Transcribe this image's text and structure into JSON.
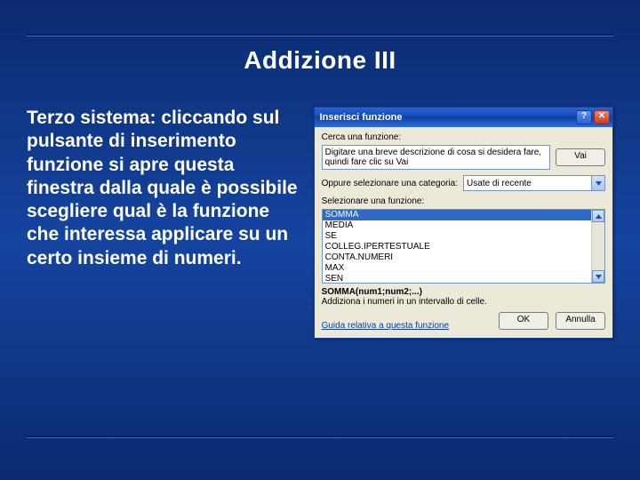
{
  "slide": {
    "title": "Addizione III",
    "description": "Terzo sistema: cliccando sul pulsante di inserimento funzione si apre questa finestra dalla quale è possibile scegliere qual è la funzione che interessa applicare su un certo insieme di numeri."
  },
  "dialog": {
    "title": "Inserisci funzione",
    "search_label": "Cerca una funzione:",
    "search_value": "Digitare una breve descrizione di cosa si desidera fare, quindi fare clic su Vai",
    "go_button": "Vai",
    "category_label": "Oppure selezionare una categoria:",
    "category_selected": "Usate di recente",
    "list_label": "Selezionare una funzione:",
    "functions": [
      "SOMMA",
      "MEDIA",
      "SE",
      "COLLEG.IPERTESTUALE",
      "CONTA.NUMERI",
      "MAX",
      "SEN"
    ],
    "signature": "SOMMA(num1;num2;...)",
    "signature_desc": "Addiziona i numeri in un intervallo di celle.",
    "help_link": "Guida relativa a questa funzione",
    "ok_button": "OK",
    "cancel_button": "Annulla"
  }
}
